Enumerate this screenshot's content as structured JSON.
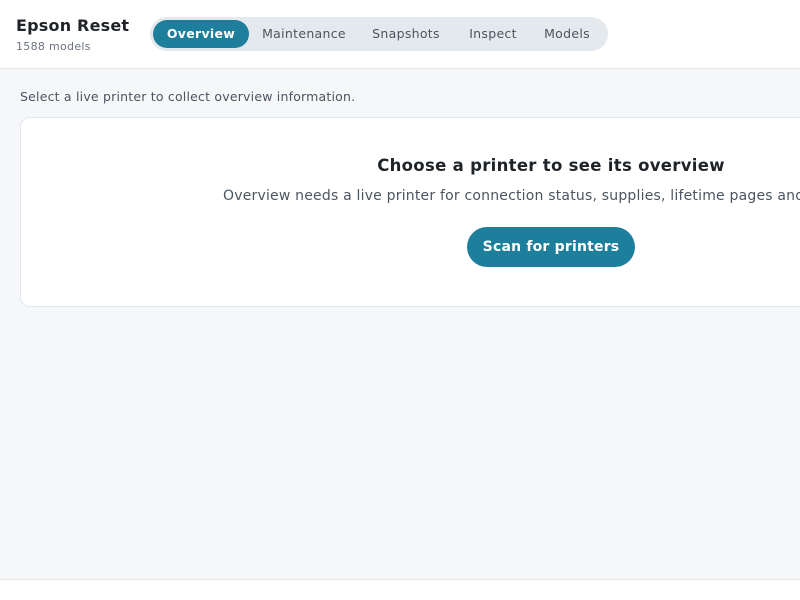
{
  "app": {
    "title": "Epson Reset",
    "subtitle": "1588 models"
  },
  "tabs": [
    {
      "label": "Overview",
      "active": true
    },
    {
      "label": "Maintenance",
      "active": false
    },
    {
      "label": "Snapshots",
      "active": false
    },
    {
      "label": "Inspect",
      "active": false
    },
    {
      "label": "Models",
      "active": false
    }
  ],
  "main": {
    "hint": "Select a live printer to collect overview information.",
    "empty_state": {
      "title": "Choose a printer to see its overview",
      "description": "Overview needs a live printer for connection status, supplies, lifetime pages and",
      "button_label": "Scan for printers"
    }
  },
  "colors": {
    "accent": "#1d7f9b",
    "background": "#f6f7f9",
    "surface": "#ffffff"
  }
}
